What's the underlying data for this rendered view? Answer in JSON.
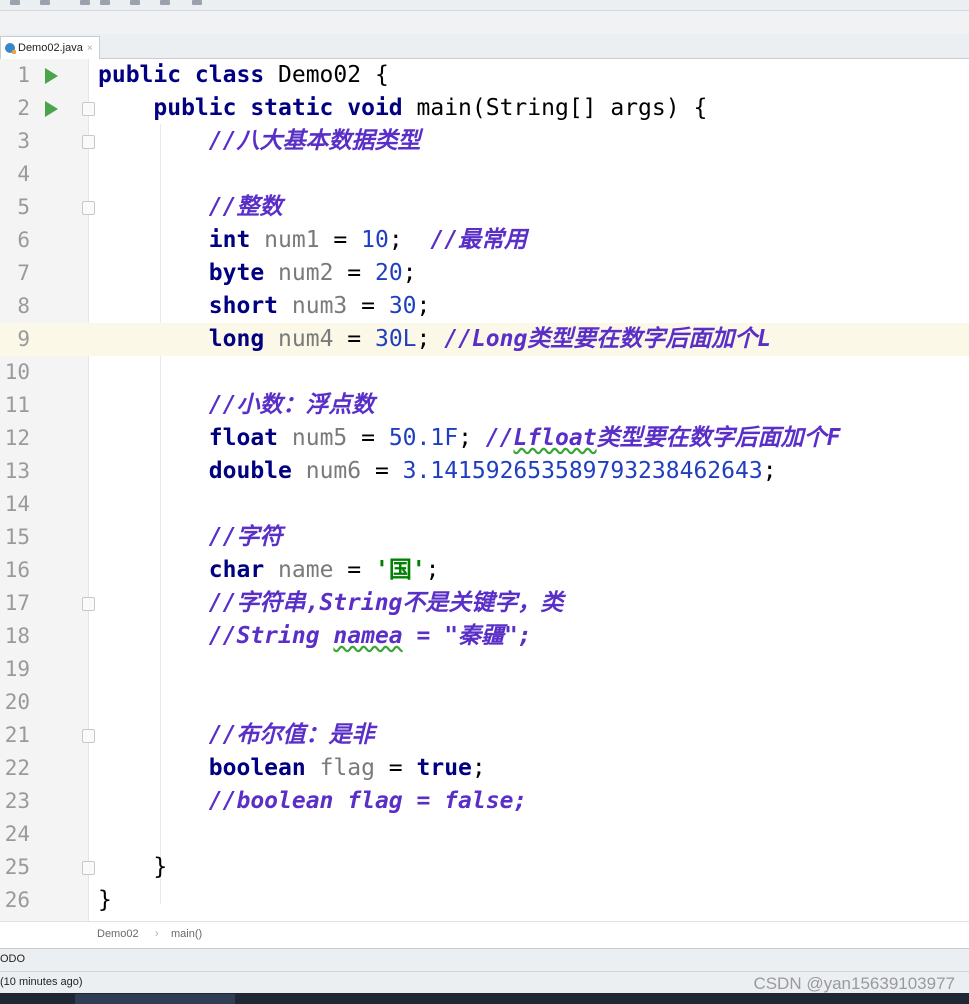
{
  "tab": {
    "label": "Demo02.java",
    "close": "×"
  },
  "code_lines": [
    {
      "n": "1",
      "run": true,
      "fold": false,
      "current": false,
      "tokens": [
        {
          "t": "kw",
          "s": "public class "
        },
        {
          "t": "plain",
          "s": "Demo02 {"
        }
      ]
    },
    {
      "n": "2",
      "run": true,
      "fold": true,
      "current": false,
      "tokens": [
        {
          "t": "plain",
          "s": "    "
        },
        {
          "t": "kw",
          "s": "public static void "
        },
        {
          "t": "plain",
          "s": "main(String[] args) {"
        }
      ]
    },
    {
      "n": "3",
      "run": false,
      "fold": true,
      "current": false,
      "tokens": [
        {
          "t": "plain",
          "s": "        "
        },
        {
          "t": "cm",
          "s": "//八大基本数据类型"
        }
      ]
    },
    {
      "n": "4",
      "run": false,
      "fold": false,
      "current": false,
      "tokens": []
    },
    {
      "n": "5",
      "run": false,
      "fold": true,
      "current": false,
      "tokens": [
        {
          "t": "plain",
          "s": "        "
        },
        {
          "t": "cm",
          "s": "//整数"
        }
      ]
    },
    {
      "n": "6",
      "run": false,
      "fold": false,
      "current": false,
      "tokens": [
        {
          "t": "plain",
          "s": "        "
        },
        {
          "t": "kw",
          "s": "int "
        },
        {
          "t": "var",
          "s": "num1"
        },
        {
          "t": "plain",
          "s": " = "
        },
        {
          "t": "num",
          "s": "10"
        },
        {
          "t": "plain",
          "s": ";  "
        },
        {
          "t": "cm",
          "s": "//最常用"
        }
      ]
    },
    {
      "n": "7",
      "run": false,
      "fold": false,
      "current": false,
      "tokens": [
        {
          "t": "plain",
          "s": "        "
        },
        {
          "t": "kw",
          "s": "byte "
        },
        {
          "t": "var",
          "s": "num2"
        },
        {
          "t": "plain",
          "s": " = "
        },
        {
          "t": "num",
          "s": "20"
        },
        {
          "t": "plain",
          "s": ";"
        }
      ]
    },
    {
      "n": "8",
      "run": false,
      "fold": false,
      "current": false,
      "tokens": [
        {
          "t": "plain",
          "s": "        "
        },
        {
          "t": "kw",
          "s": "short "
        },
        {
          "t": "var",
          "s": "num3"
        },
        {
          "t": "plain",
          "s": " = "
        },
        {
          "t": "num",
          "s": "30"
        },
        {
          "t": "plain",
          "s": ";"
        }
      ]
    },
    {
      "n": "9",
      "run": false,
      "fold": false,
      "current": true,
      "tokens": [
        {
          "t": "plain",
          "s": "        "
        },
        {
          "t": "kw",
          "s": "long "
        },
        {
          "t": "var",
          "s": "num4"
        },
        {
          "t": "plain",
          "s": " = "
        },
        {
          "t": "num",
          "s": "30L"
        },
        {
          "t": "plain",
          "s": "; "
        },
        {
          "t": "cm",
          "s": "//Long类型要在数字后面加个L"
        }
      ]
    },
    {
      "n": "10",
      "run": false,
      "fold": false,
      "current": false,
      "tokens": []
    },
    {
      "n": "11",
      "run": false,
      "fold": false,
      "current": false,
      "tokens": [
        {
          "t": "plain",
          "s": "        "
        },
        {
          "t": "cm",
          "s": "//小数：浮点数"
        }
      ]
    },
    {
      "n": "12",
      "run": false,
      "fold": false,
      "current": false,
      "tokens": [
        {
          "t": "plain",
          "s": "        "
        },
        {
          "t": "kw",
          "s": "float "
        },
        {
          "t": "var",
          "s": "num5"
        },
        {
          "t": "plain",
          "s": " = "
        },
        {
          "t": "num",
          "s": "50.1F"
        },
        {
          "t": "plain",
          "s": "; "
        },
        {
          "t": "cm",
          "s": "//"
        },
        {
          "t": "cm squig",
          "s": "Lfloat"
        },
        {
          "t": "cm",
          "s": "类型要在数字后面加个F"
        }
      ]
    },
    {
      "n": "13",
      "run": false,
      "fold": false,
      "current": false,
      "tokens": [
        {
          "t": "plain",
          "s": "        "
        },
        {
          "t": "kw",
          "s": "double "
        },
        {
          "t": "var",
          "s": "num6"
        },
        {
          "t": "plain",
          "s": " = "
        },
        {
          "t": "num",
          "s": "3.141592653589793238462643"
        },
        {
          "t": "plain",
          "s": ";"
        }
      ]
    },
    {
      "n": "14",
      "run": false,
      "fold": false,
      "current": false,
      "tokens": []
    },
    {
      "n": "15",
      "run": false,
      "fold": false,
      "current": false,
      "tokens": [
        {
          "t": "plain",
          "s": "        "
        },
        {
          "t": "cm",
          "s": "//字符"
        }
      ]
    },
    {
      "n": "16",
      "run": false,
      "fold": false,
      "current": false,
      "tokens": [
        {
          "t": "plain",
          "s": "        "
        },
        {
          "t": "kw",
          "s": "char "
        },
        {
          "t": "var",
          "s": "name"
        },
        {
          "t": "plain",
          "s": " = "
        },
        {
          "t": "str",
          "s": "'国'"
        },
        {
          "t": "plain",
          "s": ";"
        }
      ]
    },
    {
      "n": "17",
      "run": false,
      "fold": true,
      "current": false,
      "tokens": [
        {
          "t": "plain",
          "s": "        "
        },
        {
          "t": "cm",
          "s": "//字符串,String不是关键字，类"
        }
      ]
    },
    {
      "n": "18",
      "run": false,
      "fold": false,
      "current": false,
      "tokens": [
        {
          "t": "plain",
          "s": "        "
        },
        {
          "t": "cm",
          "s": "//String "
        },
        {
          "t": "cm squig",
          "s": "namea"
        },
        {
          "t": "cm",
          "s": " = \"秦疆\";"
        }
      ]
    },
    {
      "n": "19",
      "run": false,
      "fold": false,
      "current": false,
      "tokens": []
    },
    {
      "n": "20",
      "run": false,
      "fold": false,
      "current": false,
      "tokens": []
    },
    {
      "n": "21",
      "run": false,
      "fold": true,
      "current": false,
      "tokens": [
        {
          "t": "plain",
          "s": "        "
        },
        {
          "t": "cm",
          "s": "//布尔值：是非"
        }
      ]
    },
    {
      "n": "22",
      "run": false,
      "fold": false,
      "current": false,
      "tokens": [
        {
          "t": "plain",
          "s": "        "
        },
        {
          "t": "kw",
          "s": "boolean "
        },
        {
          "t": "var",
          "s": "flag"
        },
        {
          "t": "plain",
          "s": " = "
        },
        {
          "t": "kw",
          "s": "true"
        },
        {
          "t": "plain",
          "s": ";"
        }
      ]
    },
    {
      "n": "23",
      "run": false,
      "fold": false,
      "current": false,
      "tokens": [
        {
          "t": "plain",
          "s": "        "
        },
        {
          "t": "cm",
          "s": "//boolean flag = false;"
        }
      ]
    },
    {
      "n": "24",
      "run": false,
      "fold": false,
      "current": false,
      "tokens": []
    },
    {
      "n": "25",
      "run": false,
      "fold": true,
      "current": false,
      "tokens": [
        {
          "t": "plain",
          "s": "    }"
        }
      ]
    },
    {
      "n": "26",
      "run": false,
      "fold": false,
      "current": false,
      "tokens": [
        {
          "t": "plain",
          "s": "}"
        }
      ]
    }
  ],
  "breadcrumb": {
    "class_name": "Demo02",
    "separator": "›",
    "method_name": "main()"
  },
  "todo_bar": {
    "label": "ODO"
  },
  "status_bar": {
    "label": "(10 minutes ago)"
  },
  "watermark": "CSDN @yan15639103977"
}
